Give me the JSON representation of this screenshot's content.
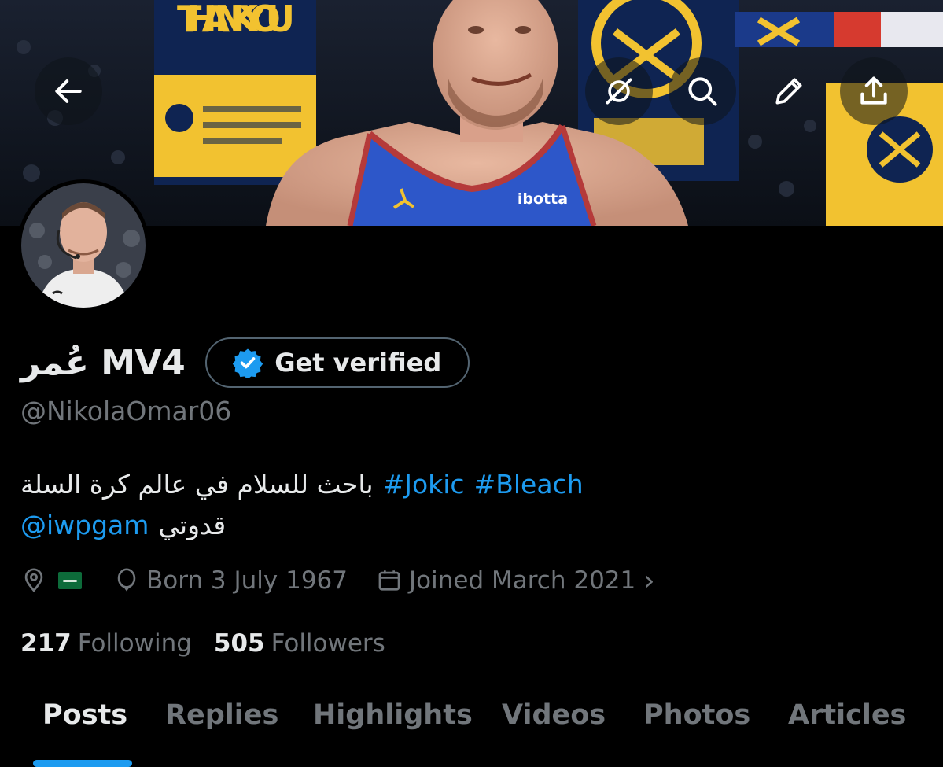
{
  "header": {
    "back_icon": "arrow-left-icon",
    "grok_icon": "grok-icon",
    "search_icon": "search-icon",
    "edit_icon": "pencil-icon",
    "share_icon": "share-icon",
    "banner_texts": {
      "thank_you": "THANK YOU",
      "sponsor": "ibotta"
    }
  },
  "profile": {
    "display_name": "عُمر MV4",
    "verify_label": "Get verified",
    "handle": "@NikolaOmar06",
    "bio": {
      "line1_text": "باحث للسلام في عالم كرة السلة",
      "hashtag1": "#Jokic",
      "hashtag2": "#Bleach",
      "line2_text": "قدوتي",
      "mention": "@iwpgam"
    },
    "meta": {
      "location_icon": "location-pin-icon",
      "flag": "saudi-arabia-flag",
      "birth_icon": "balloon-icon",
      "born": "Born 3 July 1967",
      "calendar_icon": "calendar-icon",
      "joined": "Joined March 2021",
      "chevron": "›"
    },
    "stats": {
      "following_count": "217",
      "following_label": "Following",
      "followers_count": "505",
      "followers_label": "Followers"
    }
  },
  "tabs": [
    {
      "label": "Posts",
      "active": true
    },
    {
      "label": "Replies",
      "active": false
    },
    {
      "label": "Highlights",
      "active": false
    },
    {
      "label": "Videos",
      "active": false
    },
    {
      "label": "Photos",
      "active": false
    },
    {
      "label": "Articles",
      "active": false
    }
  ],
  "colors": {
    "background": "#000000",
    "text_primary": "#e7e9ea",
    "text_secondary": "#71767b",
    "accent_blue": "#1d9bf0",
    "border": "#536471"
  }
}
